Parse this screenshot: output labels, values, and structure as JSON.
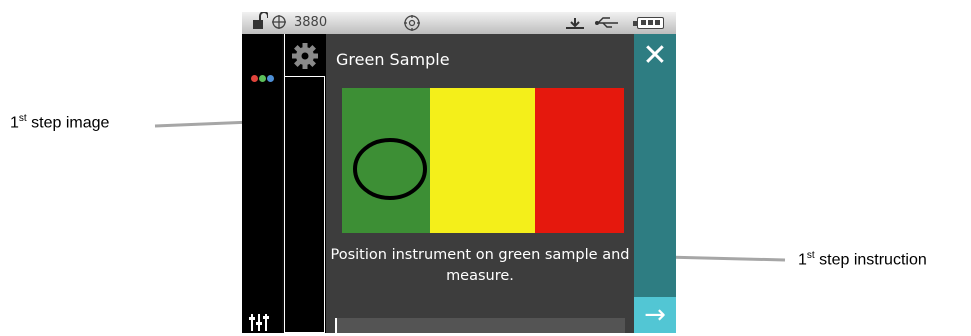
{
  "statusbar": {
    "count": "3880"
  },
  "screen": {
    "title": "Green Sample",
    "instruction": "Position instrument on green sample and measure.",
    "close_label": "✕",
    "next_label": "→"
  },
  "callouts": {
    "image_num": "1",
    "image_sup": "st",
    "image_text": " step image",
    "instruction_num": "1",
    "instruction_sup": "st",
    "instruction_text": " step instruction"
  },
  "colors": {
    "green": "#3d8f35",
    "yellow": "#f4ef1a",
    "red": "#e5180d",
    "teal": "#2e7d82",
    "next_button": "#52c6d4"
  },
  "icons": {
    "lock": "unlock-icon",
    "target": "crosshair-icon",
    "usb": "usb-icon",
    "battery": "battery-icon"
  }
}
